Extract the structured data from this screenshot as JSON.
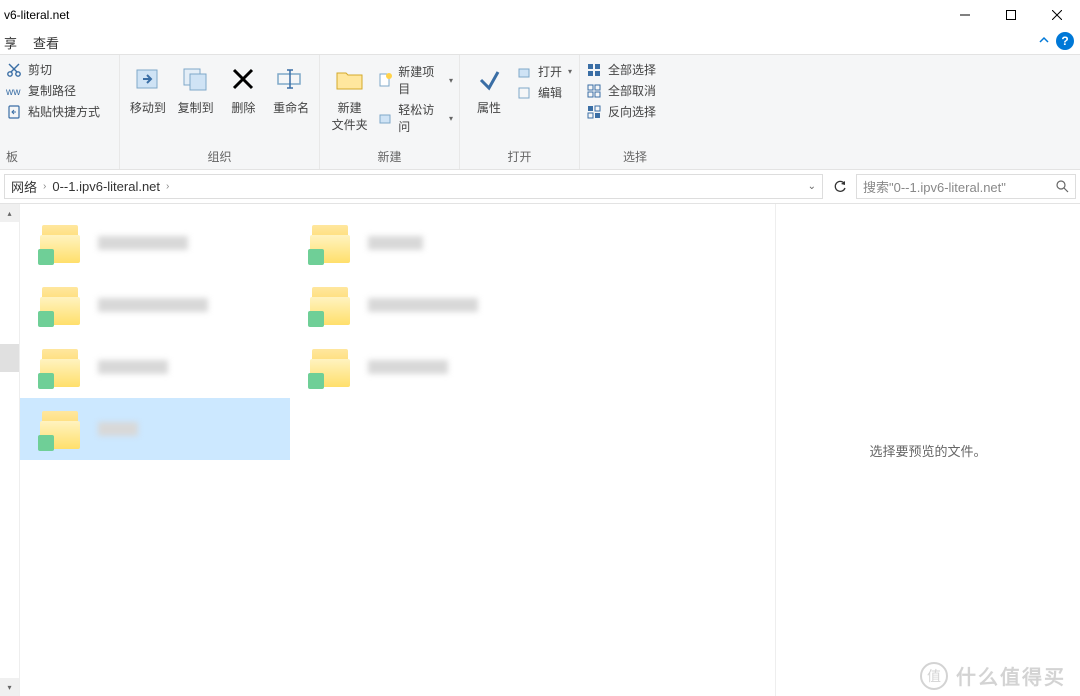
{
  "titlebar": {
    "title": "v6-literal.net"
  },
  "menu": {
    "share": "享",
    "view": "查看"
  },
  "ribbon": {
    "clipboard": {
      "cut": "剪切",
      "copy_path": "复制路径",
      "paste_shortcut": "粘贴快捷方式",
      "label": "板"
    },
    "organize": {
      "move_to": "移动到",
      "copy_to": "复制到",
      "delete": "删除",
      "rename": "重命名",
      "label": "组织"
    },
    "new": {
      "new_folder": "新建\n文件夹",
      "new_item": "新建项目",
      "easy_access": "轻松访问",
      "label": "新建"
    },
    "open": {
      "properties": "属性",
      "open": "打开",
      "edit": "编辑",
      "label": "打开"
    },
    "select": {
      "select_all": "全部选择",
      "select_none": "全部取消",
      "invert": "反向选择",
      "label": "选择"
    }
  },
  "address": {
    "root": "网络",
    "path": "0--1.ipv6-literal.net"
  },
  "search": {
    "placeholder": "搜索\"0--1.ipv6-literal.net\""
  },
  "preview": {
    "message": "选择要预览的文件。"
  },
  "watermark": {
    "text": "什么值得买",
    "badge": "值"
  }
}
